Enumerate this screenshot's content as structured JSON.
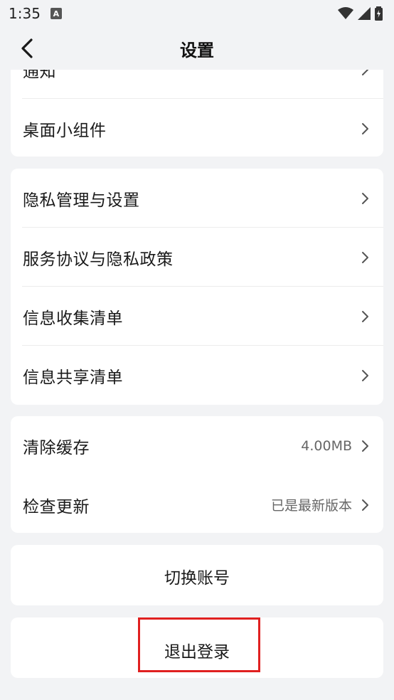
{
  "status_bar": {
    "time": "1:35",
    "app_icon_letter": "A"
  },
  "header": {
    "title": "设置"
  },
  "group1": {
    "items": [
      {
        "label": "通知"
      },
      {
        "label": "桌面小组件"
      }
    ]
  },
  "group2": {
    "items": [
      {
        "label": "隐私管理与设置"
      },
      {
        "label": "服务协议与隐私政策"
      },
      {
        "label": "信息收集清单"
      },
      {
        "label": "信息共享清单"
      }
    ]
  },
  "group3": {
    "items": [
      {
        "label": "清除缓存",
        "value": "4.00MB"
      },
      {
        "label": "检查更新",
        "value": "已是最新版本"
      }
    ]
  },
  "switch_account": {
    "label": "切换账号"
  },
  "logout": {
    "label": "退出登录"
  },
  "colors": {
    "background": "#f2f3f5",
    "card": "#ffffff",
    "highlight": "#e02020"
  }
}
